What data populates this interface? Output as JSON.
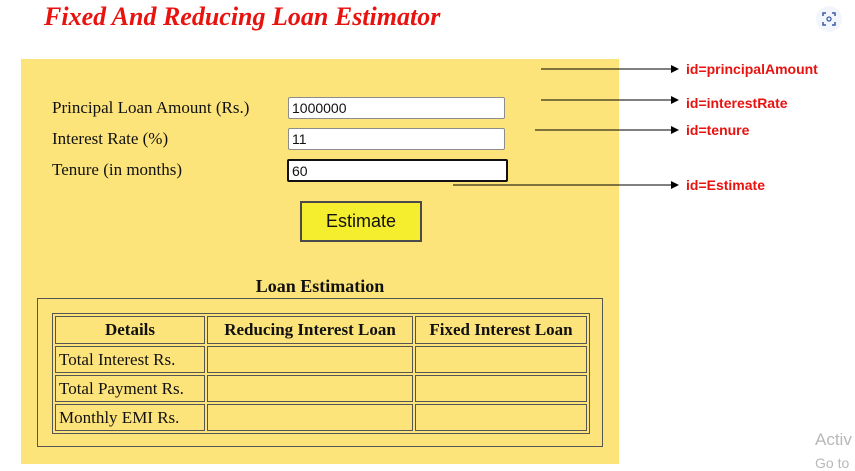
{
  "page": {
    "title": "Fixed And Reducing Loan Estimator",
    "icons": {
      "scan": "scan-icon"
    }
  },
  "form": {
    "principal_label": "Principal Loan Amount (Rs.)",
    "principal_value": "1000000",
    "rate_label": "Interest Rate (%)",
    "rate_value": "11",
    "tenure_label": "Tenure (in months)",
    "tenure_value": "60",
    "estimate_label": "Estimate"
  },
  "estimation": {
    "caption": "Loan Estimation",
    "headers": [
      "Details",
      "Reducing Interest Loan",
      "Fixed Interest Loan"
    ],
    "rows": [
      {
        "label": "Total Interest Rs.",
        "reducing": "",
        "fixed": ""
      },
      {
        "label": "Total Payment Rs.",
        "reducing": "",
        "fixed": ""
      },
      {
        "label": "Monthly EMI Rs.",
        "reducing": "",
        "fixed": ""
      }
    ]
  },
  "annotations": [
    "id=principalAmount",
    "id=interestRate",
    "id=tenure",
    "id=Estimate"
  ],
  "watermark": {
    "line1": "Activ",
    "line2": "Go to"
  },
  "colors": {
    "title": "#e8120f",
    "panel": "#fde47a",
    "button": "#f4ee2f",
    "annotation": "#e8120f"
  }
}
